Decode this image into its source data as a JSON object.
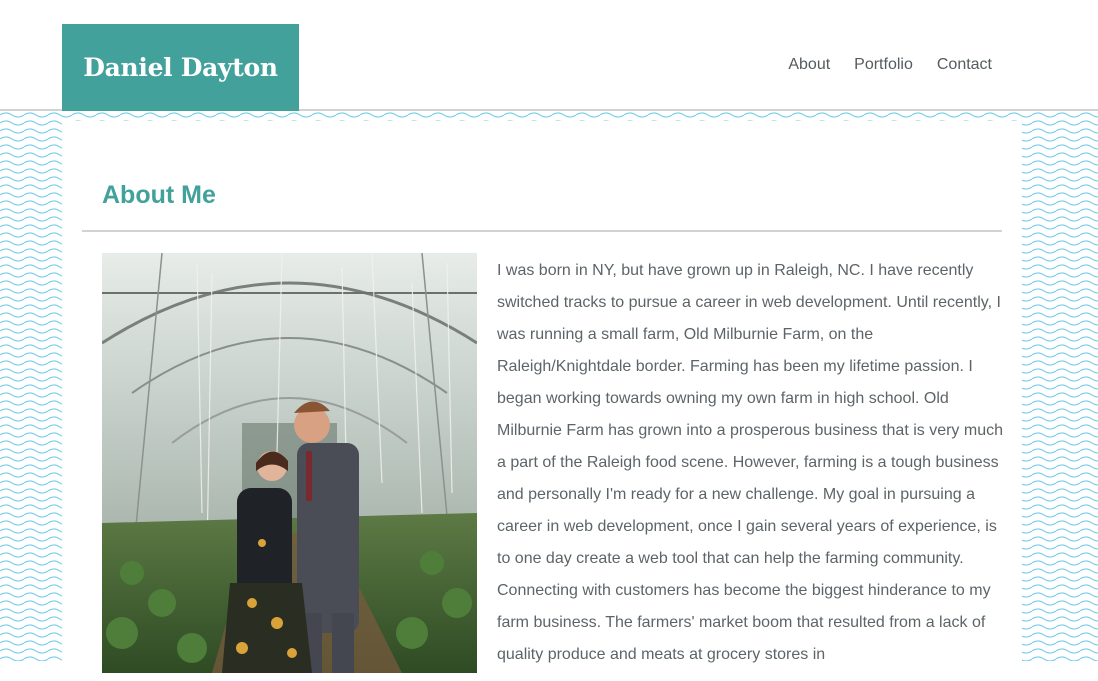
{
  "header": {
    "logo_text": "Daniel Dayton",
    "nav": [
      "About",
      "Portfolio",
      "Contact"
    ]
  },
  "main": {
    "title": "About Me",
    "bio": "I was born in NY, but have grown up in Raleigh, NC. I have recently switched tracks to pursue a career in web development. Until recently, I was running a small farm, Old Milburnie Farm, on the Raleigh/Knightdale border. Farming has been my lifetime passion. I began working towards owning my own farm in high school. Old Milburnie Farm has grown into a prosperous business that is very much a part of the Raleigh food scene. However, farming is a tough business and personally I'm ready for a new challenge. My goal in pursuing a career in web development, once I gain several years of experience, is to one day create a web tool that can help the farming community. Connecting with customers has become the biggest hinderance to my farm business. The farmers' market boom that resulted from a lack of quality produce and meats at grocery stores in"
  },
  "colors": {
    "accent": "#42a19b",
    "wave": "#7fd0ec",
    "text": "#5d6468",
    "nav_text": "#555b5f"
  }
}
